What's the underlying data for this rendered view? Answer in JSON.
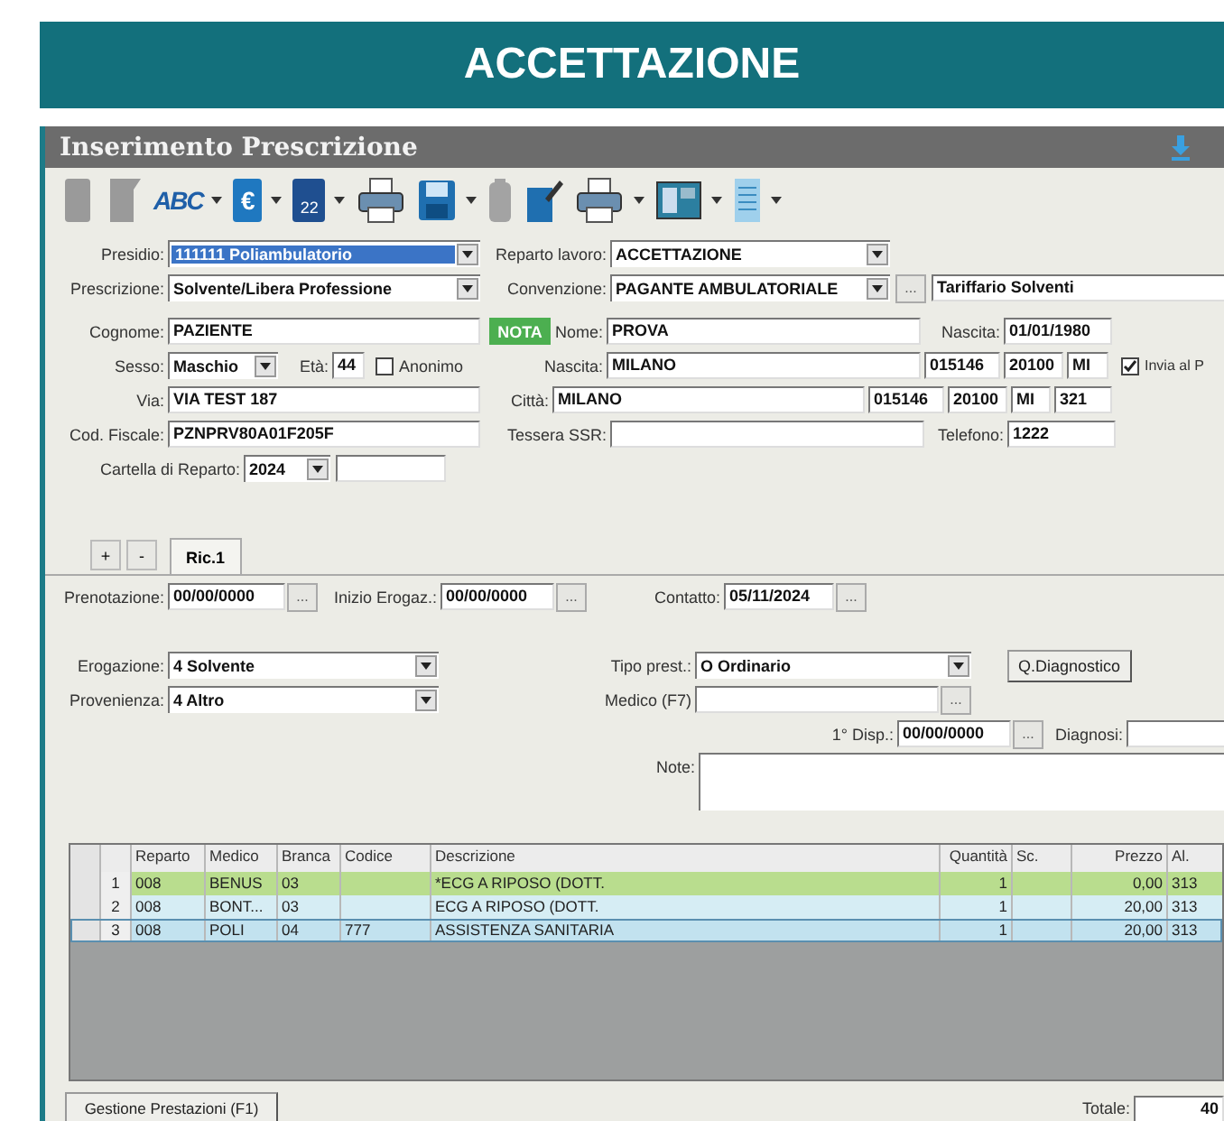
{
  "banner": {
    "title": "ACCETTAZIONE"
  },
  "window": {
    "title": "Inserimento Prescrizione"
  },
  "toolbar": [
    {
      "kind": "blank-doc",
      "dropdown": false
    },
    {
      "kind": "folded-doc",
      "dropdown": false
    },
    {
      "kind": "abc",
      "label": "ABC",
      "dropdown": true
    },
    {
      "kind": "euro",
      "label": "€",
      "dropdown": true
    },
    {
      "kind": "calendar",
      "label": "22",
      "dropdown": true
    },
    {
      "kind": "printer",
      "dropdown": false
    },
    {
      "kind": "disk",
      "dropdown": true
    },
    {
      "kind": "trash",
      "dropdown": false
    },
    {
      "kind": "pen-folder",
      "dropdown": false
    },
    {
      "kind": "printer",
      "dropdown": true
    },
    {
      "kind": "panel",
      "dropdown": true
    },
    {
      "kind": "list",
      "dropdown": true
    }
  ],
  "header": {
    "presidio": {
      "label": "Presidio:",
      "value": "111111 Poliambulatorio",
      "selected": true
    },
    "reparto_lavoro": {
      "label": "Reparto lavoro:",
      "value": "ACCETTAZIONE"
    },
    "prescrizione": {
      "label": "Prescrizione:",
      "value": "Solvente/Libera Professione"
    },
    "convenzione": {
      "label": "Convenzione:",
      "value": "PAGANTE AMBULATORIALE",
      "button": "..."
    },
    "tariffario": {
      "value": "Tariffario Solventi"
    }
  },
  "patient": {
    "cognome": {
      "label": "Cognome:",
      "value": "PAZIENTE"
    },
    "nota": "NOTA",
    "nome": {
      "label": "Nome:",
      "value": "PROVA"
    },
    "data_nascita": {
      "label": "Nascita:",
      "value": "01/01/1980"
    },
    "sesso": {
      "label": "Sesso:",
      "value": "Maschio"
    },
    "eta": {
      "label": "Età:",
      "value": "44"
    },
    "anonimo": {
      "label": "Anonimo",
      "checked": false
    },
    "luogo_nascita": {
      "label": "Nascita:",
      "value": "MILANO",
      "codes": [
        "015146",
        "20100",
        "MI"
      ]
    },
    "invia": {
      "label": "Invia al P",
      "checked": true
    },
    "via": {
      "label": "Via:",
      "value": "VIA TEST 187"
    },
    "citta": {
      "label": "Città:",
      "value": "MILANO",
      "codes": [
        "015146",
        "20100",
        "MI",
        "321"
      ]
    },
    "codice_fiscale": {
      "label": "Cod. Fiscale:",
      "value": "PZNPRV80A01F205F"
    },
    "tessera_ssr": {
      "label": "Tessera SSR:"
    },
    "telefono": {
      "label": "Telefono:",
      "value": "1222"
    },
    "cartella": {
      "label": "Cartella di Reparto:",
      "value": "2024"
    }
  },
  "tab_buttons": [
    "+",
    "-"
  ],
  "tabs": [
    {
      "label": "Ric.1",
      "selected": true
    }
  ],
  "dates": [
    {
      "label": "Prenotazione:",
      "value": "00/00/0000",
      "button": "..."
    },
    {
      "label": "Inizio Erogaz.:",
      "value": "00/00/0000",
      "button": "..."
    },
    {
      "label": "Contatto:",
      "value": "05/11/2024",
      "button": "..."
    }
  ],
  "erogazione": {
    "label": "Erogazione:",
    "value": "4 Solvente"
  },
  "provenienza": {
    "label": "Provenienza:",
    "value": "4 Altro"
  },
  "tipo_prest": {
    "label": "Tipo prest.:",
    "value": "O Ordinario"
  },
  "diagnostico_button": "Q.Diagnostico",
  "medico": {
    "label": "Medico (F7)",
    "button": "..."
  },
  "prima_disp": {
    "label": "1° Disp.:",
    "value": "00/00/0000",
    "button": "..."
  },
  "diagnosi": {
    "label": "Diagnosi:"
  },
  "note": {
    "label": "Note:"
  },
  "table": {
    "columns": [
      "Reparto",
      "Medico",
      "Branca",
      "Codice",
      "Descrizione",
      "Quantità",
      "Sc.",
      "Prezzo",
      "Al."
    ],
    "rows": [
      {
        "number": "1",
        "color": "#b9dd8e",
        "selected": false,
        "cells": [
          "008",
          "BENUS",
          "03",
          null,
          "*ECG A RIPOSO (DOTT.",
          "1",
          null,
          "0,00",
          "313"
        ]
      },
      {
        "number": "2",
        "color": "#d6edf4",
        "selected": false,
        "cells": [
          "008",
          "BONT...",
          "03",
          null,
          "ECG A RIPOSO (DOTT.",
          "1",
          null,
          "20,00",
          "313"
        ]
      },
      {
        "number": "3",
        "color": "#c2e2ef",
        "selected": true,
        "cells": [
          "008",
          "POLI",
          "04",
          "777",
          "ASSISTENZA SANITARIA",
          "1",
          null,
          "20,00",
          "313"
        ]
      }
    ]
  },
  "footer": {
    "button": "Gestione Prestazioni (F1)",
    "total_label": "Totale:",
    "total_value": "40"
  }
}
